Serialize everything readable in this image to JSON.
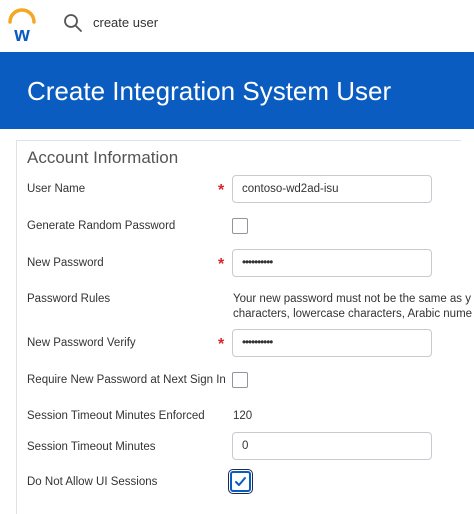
{
  "header": {
    "logo_icon": "workday-w-logo",
    "search_icon": "search-icon",
    "search_value": "create user"
  },
  "banner": {
    "title": "Create Integration System User",
    "color": "#0A5CC1"
  },
  "form": {
    "section_title": "Account Information",
    "user_name": {
      "label": "User Name",
      "value": "contoso-wd2ad-isu",
      "required": true
    },
    "generate_random_password": {
      "label": "Generate Random Password",
      "checked": false
    },
    "new_password": {
      "label": "New Password",
      "value": "••••••••••",
      "required": true
    },
    "password_rules": {
      "label": "Password Rules",
      "line1": "Your new password must not be the same as y",
      "line2": "characters, lowercase characters, Arabic nume"
    },
    "new_password_verify": {
      "label": "New Password Verify",
      "value": "••••••••••",
      "required": true
    },
    "require_new_password": {
      "label": "Require New Password at Next Sign In",
      "checked": false
    },
    "session_timeout_enforced": {
      "label": "Session Timeout Minutes Enforced",
      "value": "120"
    },
    "session_timeout_minutes": {
      "label": "Session Timeout Minutes",
      "value": "0"
    },
    "do_not_allow_ui_sessions": {
      "label": "Do Not Allow UI Sessions",
      "checked": true
    }
  },
  "required_marker": "*"
}
